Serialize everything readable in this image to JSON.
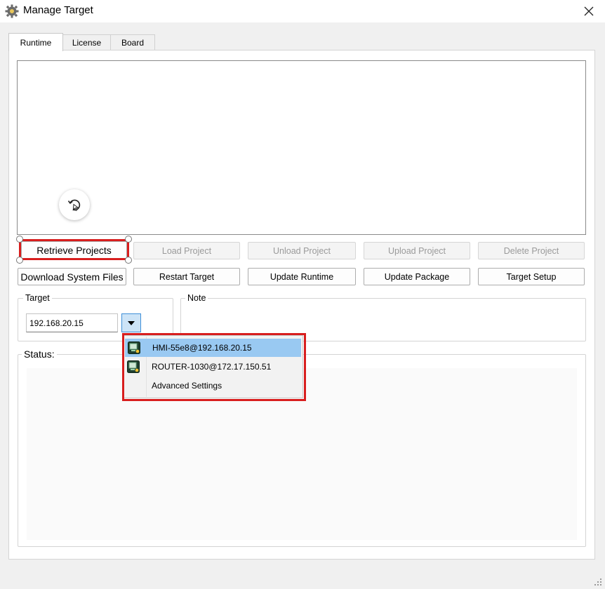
{
  "window": {
    "title": "Manage Target"
  },
  "tabs": [
    {
      "label": "Runtime",
      "active": true
    },
    {
      "label": "License",
      "active": false
    },
    {
      "label": "Board",
      "active": false
    }
  ],
  "buttons": {
    "row1": [
      {
        "label": "Retrieve Projects",
        "enabled": true
      },
      {
        "label": "Load Project",
        "enabled": false
      },
      {
        "label": "Unload Project",
        "enabled": false
      },
      {
        "label": "Upload Project",
        "enabled": false
      },
      {
        "label": "Delete Project",
        "enabled": false
      }
    ],
    "row2": [
      {
        "label": "Download System Files",
        "enabled": true
      },
      {
        "label": "Restart Target",
        "enabled": true
      },
      {
        "label": "Update Runtime",
        "enabled": true
      },
      {
        "label": "Update Package",
        "enabled": true
      },
      {
        "label": "Target Setup",
        "enabled": true
      }
    ]
  },
  "target": {
    "label": "Target",
    "value": "192.168.20.15"
  },
  "note": {
    "label": "Note"
  },
  "status": {
    "label": "Status:"
  },
  "dropdown": {
    "items": [
      {
        "label": "HMI-55e8@192.168.20.15",
        "icon": "hmi-device-icon",
        "selected": true
      },
      {
        "label": "ROUTER-1030@172.17.150.51",
        "icon": "router-device-icon",
        "selected": false
      },
      {
        "label": "Advanced Settings",
        "icon": "",
        "selected": false
      }
    ]
  },
  "colors": {
    "highlight": "#d81e1e",
    "selection": "#99c9f2",
    "accent": "#3f8fd8"
  }
}
